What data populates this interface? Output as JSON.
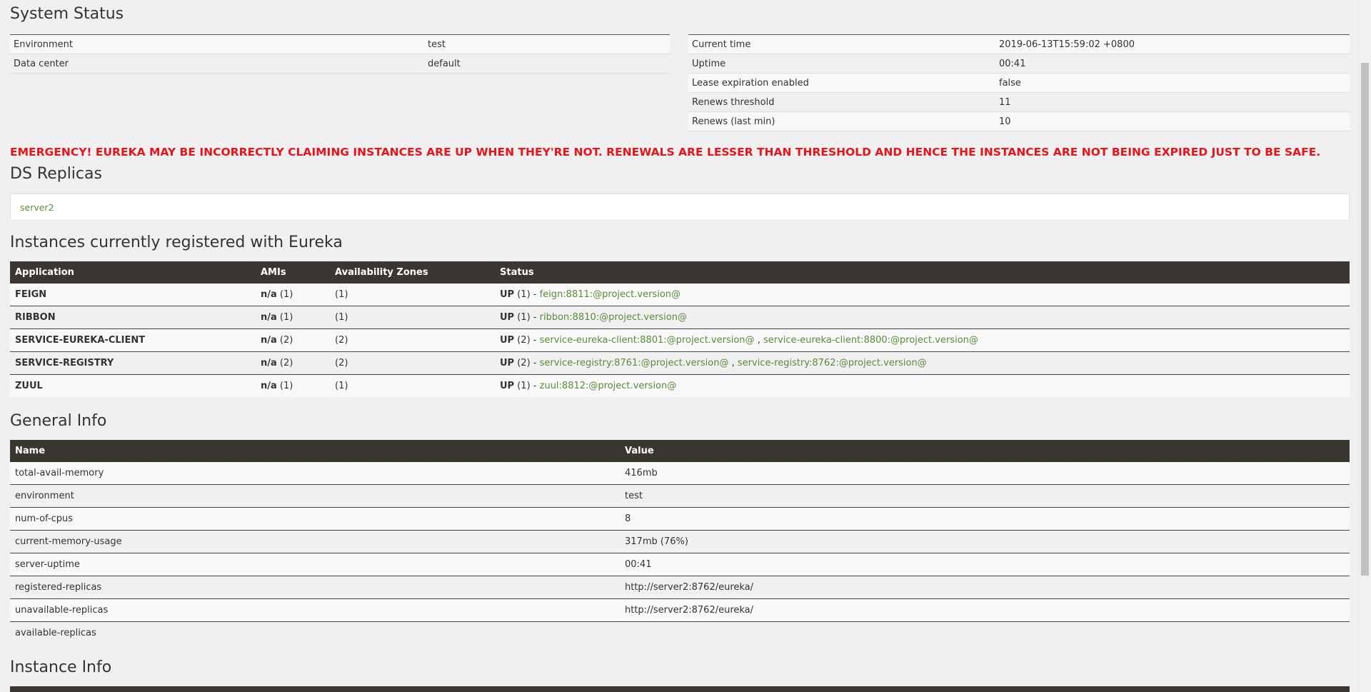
{
  "system_status": {
    "title": "System Status",
    "left": [
      {
        "key": "Environment",
        "value": "test"
      },
      {
        "key": "Data center",
        "value": "default"
      }
    ],
    "right": [
      {
        "key": "Current time",
        "value": "2019-06-13T15:59:02 +0800"
      },
      {
        "key": "Uptime",
        "value": "00:41"
      },
      {
        "key": "Lease expiration enabled",
        "value": "false"
      },
      {
        "key": "Renews threshold",
        "value": "11"
      },
      {
        "key": "Renews (last min)",
        "value": "10"
      }
    ]
  },
  "emergency": "EMERGENCY! EUREKA MAY BE INCORRECTLY CLAIMING INSTANCES ARE UP WHEN THEY'RE NOT. RENEWALS ARE LESSER THAN THRESHOLD AND HENCE THE INSTANCES ARE NOT BEING EXPIRED JUST TO BE SAFE.",
  "ds_replicas": {
    "title": "DS Replicas",
    "items": [
      "server2"
    ]
  },
  "instances": {
    "title": "Instances currently registered with Eureka",
    "headers": [
      "Application",
      "AMIs",
      "Availability Zones",
      "Status"
    ],
    "rows": [
      {
        "app": "FEIGN",
        "ami": "n/a",
        "ami_count": "(1)",
        "zones": "(1)",
        "status": "UP",
        "status_count": "(1) -",
        "links": [
          "feign:8811:@project.version@"
        ]
      },
      {
        "app": "RIBBON",
        "ami": "n/a",
        "ami_count": "(1)",
        "zones": "(1)",
        "status": "UP",
        "status_count": "(1) -",
        "links": [
          "ribbon:8810:@project.version@"
        ]
      },
      {
        "app": "SERVICE-EUREKA-CLIENT",
        "ami": "n/a",
        "ami_count": "(2)",
        "zones": "(2)",
        "status": "UP",
        "status_count": "(2) -",
        "links": [
          "service-eureka-client:8801:@project.version@",
          "service-eureka-client:8800:@project.version@"
        ]
      },
      {
        "app": "SERVICE-REGISTRY",
        "ami": "n/a",
        "ami_count": "(2)",
        "zones": "(2)",
        "status": "UP",
        "status_count": "(2) -",
        "links": [
          "service-registry:8761:@project.version@",
          "service-registry:8762:@project.version@"
        ]
      },
      {
        "app": "ZUUL",
        "ami": "n/a",
        "ami_count": "(1)",
        "zones": "(1)",
        "status": "UP",
        "status_count": "(1) -",
        "links": [
          "zuul:8812:@project.version@"
        ]
      }
    ]
  },
  "general_info": {
    "title": "General Info",
    "headers": [
      "Name",
      "Value"
    ],
    "rows": [
      {
        "name": "total-avail-memory",
        "value": "416mb"
      },
      {
        "name": "environment",
        "value": "test"
      },
      {
        "name": "num-of-cpus",
        "value": "8"
      },
      {
        "name": "current-memory-usage",
        "value": "317mb (76%)"
      },
      {
        "name": "server-uptime",
        "value": "00:41"
      },
      {
        "name": "registered-replicas",
        "value": "http://server2:8762/eureka/"
      },
      {
        "name": "unavailable-replicas",
        "value": "http://server2:8762/eureka/"
      },
      {
        "name": "available-replicas",
        "value": ""
      }
    ]
  },
  "instance_info": {
    "title": "Instance Info"
  },
  "colors": {
    "background": "#f0f0f0",
    "header_dark": "#3a3733",
    "link_green": "#5a8c3a",
    "emergency_red": "#e8141c"
  }
}
